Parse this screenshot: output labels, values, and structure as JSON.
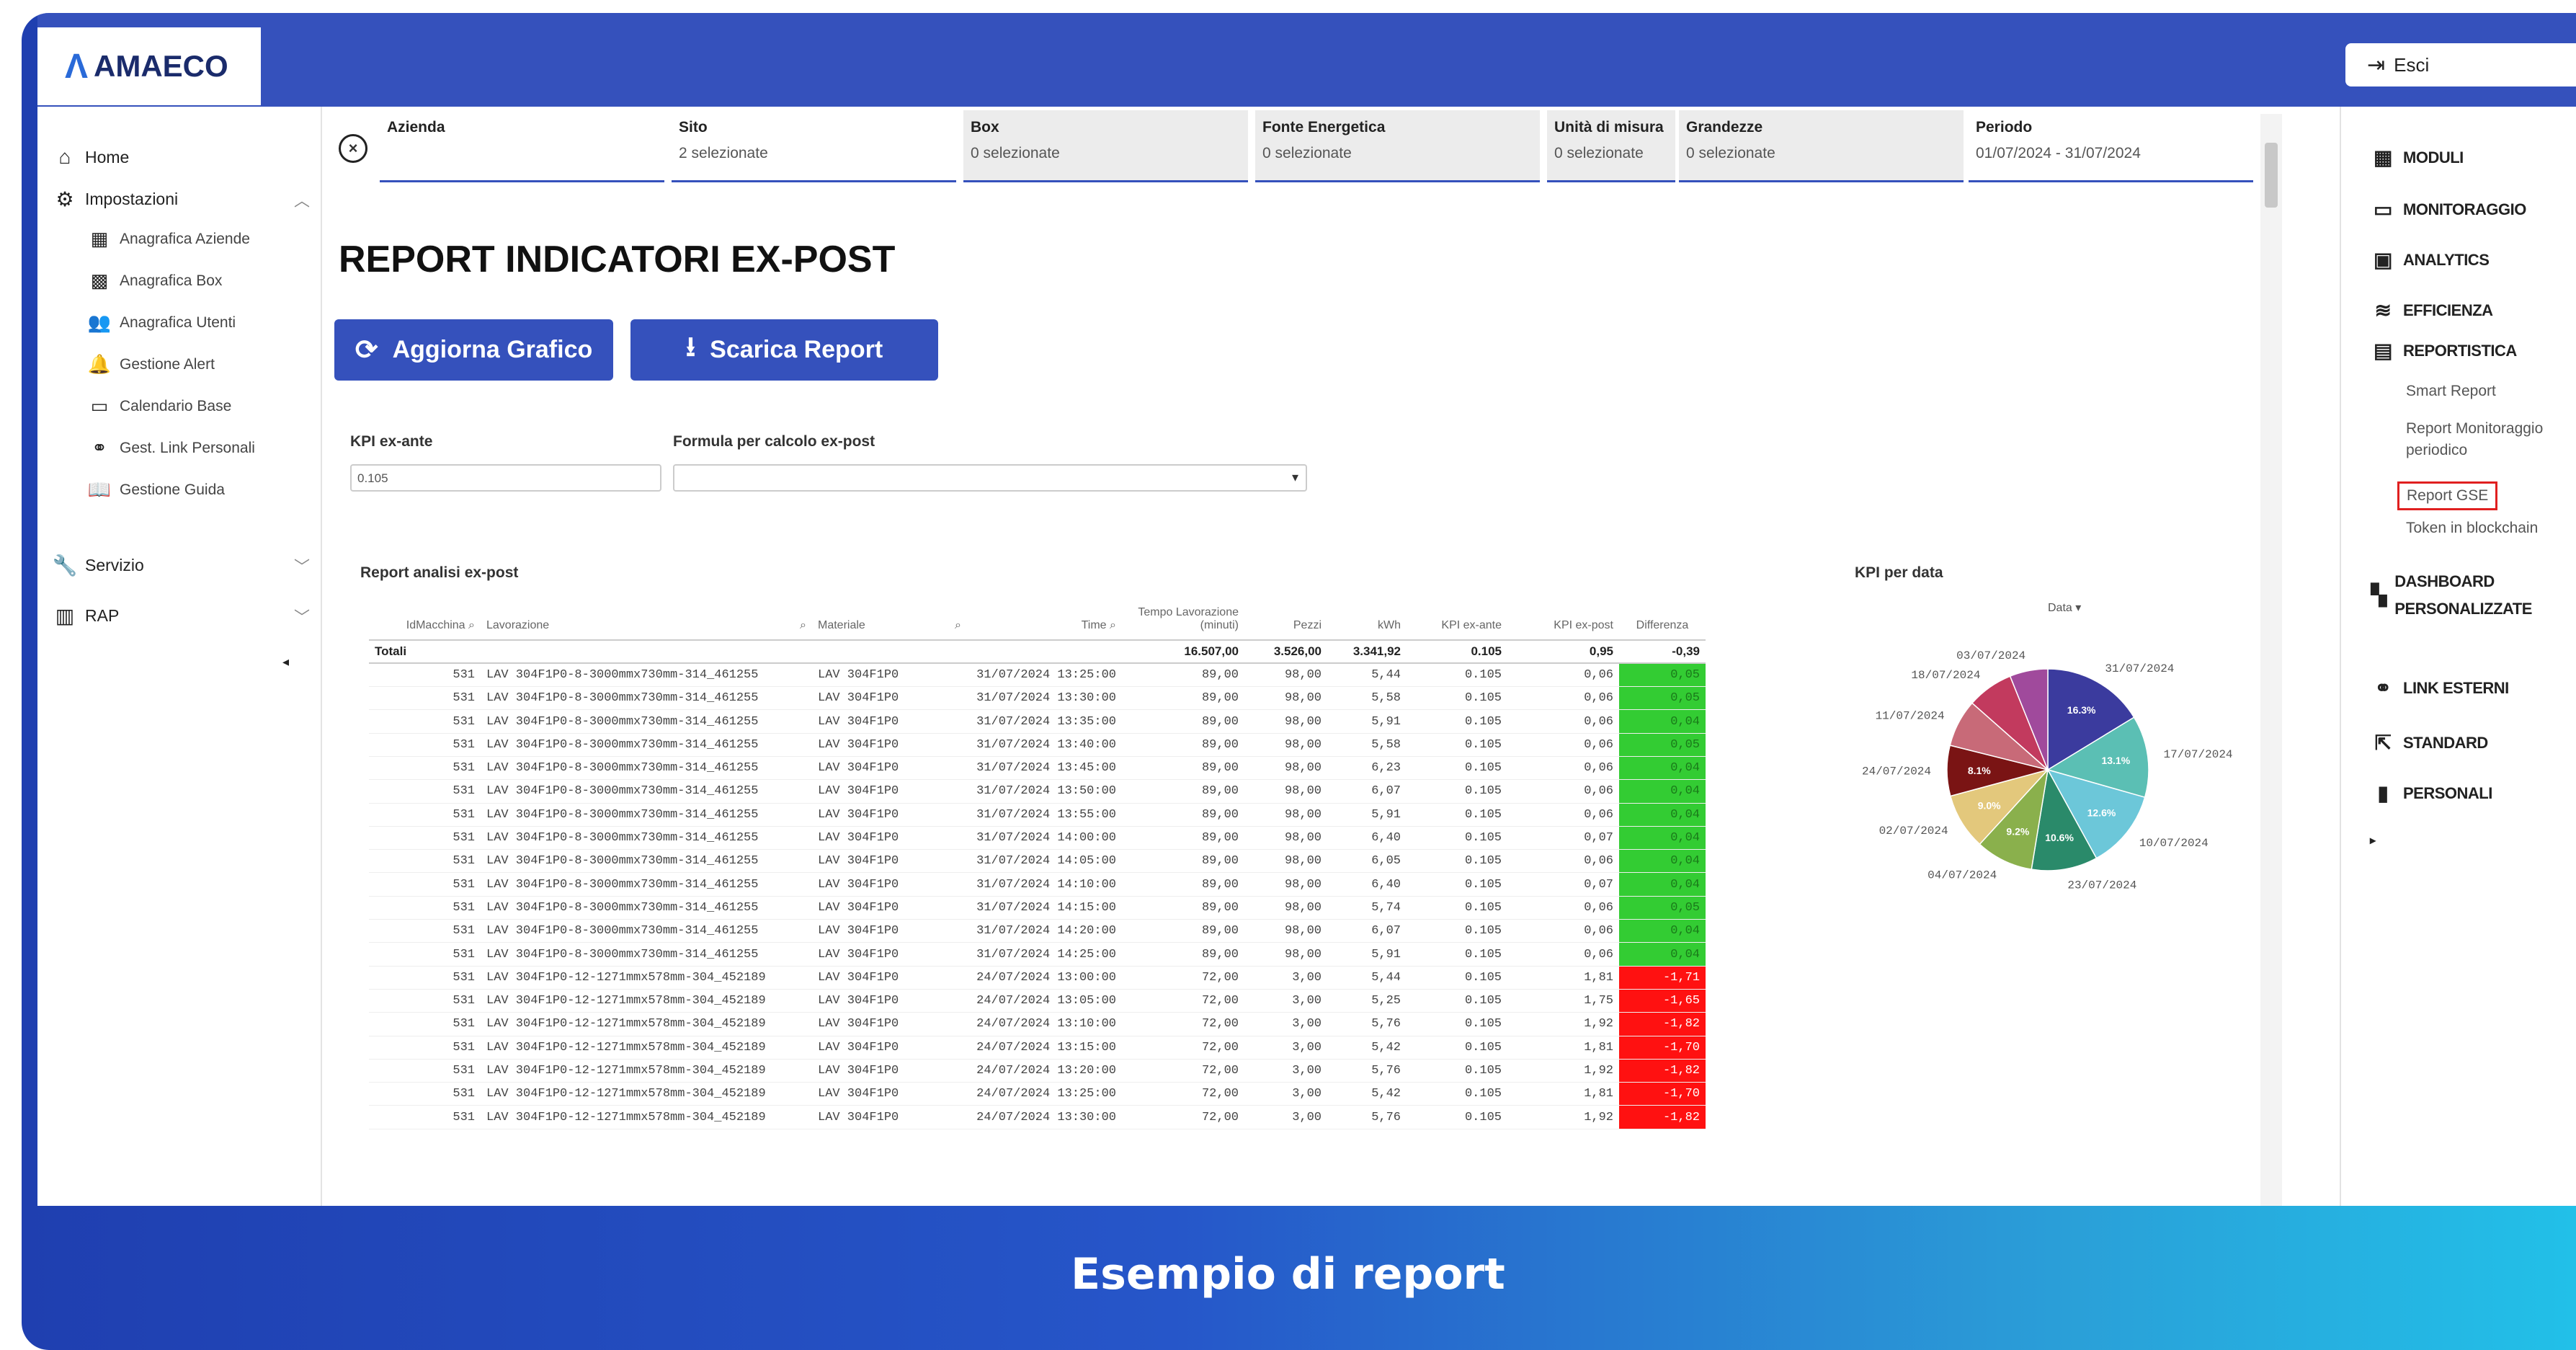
{
  "app": {
    "logo_text": "AMAECO",
    "logo_sub": "",
    "exit_label": "Esci"
  },
  "leftnav": {
    "home": "Home",
    "impostazioni": "Impostazioni",
    "sub": [
      "Anagrafica Aziende",
      "Anagrafica Box",
      "Anagrafica Utenti",
      "Gestione Alert",
      "Calendario Base",
      "Gest. Link Personali",
      "Gestione Guida"
    ],
    "servizio": "Servizio",
    "rap": "RAP"
  },
  "filters": [
    {
      "label": "Azienda",
      "value": ""
    },
    {
      "label": "Sito",
      "value": "2 selezionate"
    },
    {
      "label": "Box",
      "value": "0 selezionate"
    },
    {
      "label": "Fonte Energetica",
      "value": "0 selezionate"
    },
    {
      "label": "Unità di misura",
      "value": "0 selezionate"
    },
    {
      "label": "Grandezze",
      "value": "0 selezionate"
    },
    {
      "label": "Periodo",
      "value": "01/07/2024 - 31/07/2024"
    }
  ],
  "page": {
    "title": "REPORT INDICATORI EX-POST",
    "btn_update": "Aggiorna Grafico",
    "btn_download": "Scarica Report",
    "kpi_label": "KPI ex-ante",
    "kpi_value": "0.105",
    "formula_label": "Formula per calcolo ex-post",
    "formula_value": "",
    "report_label": "Report analisi ex-post",
    "chart_label": "KPI per data"
  },
  "table": {
    "headers": [
      "IdMacchina",
      "Lavorazione",
      "Materiale",
      "Time",
      "Tempo Lavorazione (minuti)",
      "Pezzi",
      "kWh",
      "KPI ex-ante",
      "KPI ex-post",
      "Differenza"
    ],
    "totals": [
      "Totali",
      "",
      "",
      "",
      "16.507,00",
      "3.526,00",
      "3.341,92",
      "0.105",
      "0,95",
      "-0,39"
    ],
    "rows": [
      [
        "531",
        "LAV 304F1P0-8-3000mmx730mm-314_461255",
        "LAV 304F1P0",
        "31/07/2024 13:25:00",
        "89,00",
        "98,00",
        "5,44",
        "0.105",
        "0,06",
        "0,05",
        "pos"
      ],
      [
        "531",
        "LAV 304F1P0-8-3000mmx730mm-314_461255",
        "LAV 304F1P0",
        "31/07/2024 13:30:00",
        "89,00",
        "98,00",
        "5,58",
        "0.105",
        "0,06",
        "0,05",
        "pos"
      ],
      [
        "531",
        "LAV 304F1P0-8-3000mmx730mm-314_461255",
        "LAV 304F1P0",
        "31/07/2024 13:35:00",
        "89,00",
        "98,00",
        "5,91",
        "0.105",
        "0,06",
        "0,04",
        "pos"
      ],
      [
        "531",
        "LAV 304F1P0-8-3000mmx730mm-314_461255",
        "LAV 304F1P0",
        "31/07/2024 13:40:00",
        "89,00",
        "98,00",
        "5,58",
        "0.105",
        "0,06",
        "0,05",
        "pos"
      ],
      [
        "531",
        "LAV 304F1P0-8-3000mmx730mm-314_461255",
        "LAV 304F1P0",
        "31/07/2024 13:45:00",
        "89,00",
        "98,00",
        "6,23",
        "0.105",
        "0,06",
        "0,04",
        "pos"
      ],
      [
        "531",
        "LAV 304F1P0-8-3000mmx730mm-314_461255",
        "LAV 304F1P0",
        "31/07/2024 13:50:00",
        "89,00",
        "98,00",
        "6,07",
        "0.105",
        "0,06",
        "0,04",
        "pos"
      ],
      [
        "531",
        "LAV 304F1P0-8-3000mmx730mm-314_461255",
        "LAV 304F1P0",
        "31/07/2024 13:55:00",
        "89,00",
        "98,00",
        "5,91",
        "0.105",
        "0,06",
        "0,04",
        "pos"
      ],
      [
        "531",
        "LAV 304F1P0-8-3000mmx730mm-314_461255",
        "LAV 304F1P0",
        "31/07/2024 14:00:00",
        "89,00",
        "98,00",
        "6,40",
        "0.105",
        "0,07",
        "0,04",
        "pos"
      ],
      [
        "531",
        "LAV 304F1P0-8-3000mmx730mm-314_461255",
        "LAV 304F1P0",
        "31/07/2024 14:05:00",
        "89,00",
        "98,00",
        "6,05",
        "0.105",
        "0,06",
        "0,04",
        "pos"
      ],
      [
        "531",
        "LAV 304F1P0-8-3000mmx730mm-314_461255",
        "LAV 304F1P0",
        "31/07/2024 14:10:00",
        "89,00",
        "98,00",
        "6,40",
        "0.105",
        "0,07",
        "0,04",
        "pos"
      ],
      [
        "531",
        "LAV 304F1P0-8-3000mmx730mm-314_461255",
        "LAV 304F1P0",
        "31/07/2024 14:15:00",
        "89,00",
        "98,00",
        "5,74",
        "0.105",
        "0,06",
        "0,05",
        "pos"
      ],
      [
        "531",
        "LAV 304F1P0-8-3000mmx730mm-314_461255",
        "LAV 304F1P0",
        "31/07/2024 14:20:00",
        "89,00",
        "98,00",
        "6,07",
        "0.105",
        "0,06",
        "0,04",
        "pos"
      ],
      [
        "531",
        "LAV 304F1P0-8-3000mmx730mm-314_461255",
        "LAV 304F1P0",
        "31/07/2024 14:25:00",
        "89,00",
        "98,00",
        "5,91",
        "0.105",
        "0,06",
        "0,04",
        "pos"
      ],
      [
        "531",
        "LAV 304F1P0-12-1271mmx578mm-304_452189",
        "LAV 304F1P0",
        "24/07/2024 13:00:00",
        "72,00",
        "3,00",
        "5,44",
        "0.105",
        "1,81",
        "-1,71",
        "neg"
      ],
      [
        "531",
        "LAV 304F1P0-12-1271mmx578mm-304_452189",
        "LAV 304F1P0",
        "24/07/2024 13:05:00",
        "72,00",
        "3,00",
        "5,25",
        "0.105",
        "1,75",
        "-1,65",
        "neg"
      ],
      [
        "531",
        "LAV 304F1P0-12-1271mmx578mm-304_452189",
        "LAV 304F1P0",
        "24/07/2024 13:10:00",
        "72,00",
        "3,00",
        "5,76",
        "0.105",
        "1,92",
        "-1,82",
        "neg"
      ],
      [
        "531",
        "LAV 304F1P0-12-1271mmx578mm-304_452189",
        "LAV 304F1P0",
        "24/07/2024 13:15:00",
        "72,00",
        "3,00",
        "5,42",
        "0.105",
        "1,81",
        "-1,70",
        "neg"
      ],
      [
        "531",
        "LAV 304F1P0-12-1271mmx578mm-304_452189",
        "LAV 304F1P0",
        "24/07/2024 13:20:00",
        "72,00",
        "3,00",
        "5,76",
        "0.105",
        "1,92",
        "-1,82",
        "neg"
      ],
      [
        "531",
        "LAV 304F1P0-12-1271mmx578mm-304_452189",
        "LAV 304F1P0",
        "24/07/2024 13:25:00",
        "72,00",
        "3,00",
        "5,42",
        "0.105",
        "1,81",
        "-1,70",
        "neg"
      ],
      [
        "531",
        "LAV 304F1P0-12-1271mmx578mm-304_452189",
        "LAV 304F1P0",
        "24/07/2024 13:30:00",
        "72,00",
        "3,00",
        "5,76",
        "0.105",
        "1,92",
        "-1,82",
        "neg"
      ]
    ]
  },
  "chart_data": {
    "type": "pie",
    "title": "KPI per data",
    "legend_title": "Data",
    "slices": [
      {
        "label": "31/07/2024",
        "value": 16.3,
        "pct_label": "16.3%",
        "color": "#3b3b9e"
      },
      {
        "label": "17/07/2024",
        "value": 13.1,
        "pct_label": "13.1%",
        "color": "#5bbfb4"
      },
      {
        "label": "10/07/2024",
        "value": 12.6,
        "pct_label": "12.6%",
        "color": "#6cc7d9"
      },
      {
        "label": "23/07/2024",
        "value": 10.6,
        "pct_label": "10.6%",
        "color": "#2a8a6a"
      },
      {
        "label": "04/07/2024",
        "value": 9.2,
        "pct_label": "9.2%",
        "color": "#8ab04c"
      },
      {
        "label": "02/07/2024",
        "value": 9.0,
        "pct_label": "9.0%",
        "color": "#e3c87c"
      },
      {
        "label": "24/07/2024",
        "value": 8.1,
        "pct_label": "8.1%",
        "color": "#7a1414"
      },
      {
        "label": "11/07/2024",
        "value": 7.6,
        "pct_label": "",
        "color": "#c86a78"
      },
      {
        "label": "18/07/2024",
        "value": 7.4,
        "pct_label": "",
        "color": "#c23a5e"
      },
      {
        "label": "03/07/2024",
        "value": 6.1,
        "pct_label": "",
        "color": "#a04a9c"
      }
    ]
  },
  "righttools": {
    "moduli": "MODULI",
    "monitoraggio": "MONITORAGGIO",
    "analytics": "ANALYTICS",
    "efficienza": "EFFICIENZA",
    "reportistica": "REPORTISTICA",
    "sub": [
      "Smart Report",
      "Report Monitoraggio periodico",
      "Report GSE",
      "Token in blockchain"
    ],
    "dashboard": "DASHBOARD PERSONALIZZATE",
    "link_esterni": "LINK ESTERNI",
    "standard": "STANDARD",
    "personali": "PERSONALI"
  },
  "caption": "Esempio di report",
  "colors": {
    "primary": "#3551bc",
    "positive": "#33cc33",
    "negative": "#ff1111",
    "highlight": "#e02020"
  }
}
